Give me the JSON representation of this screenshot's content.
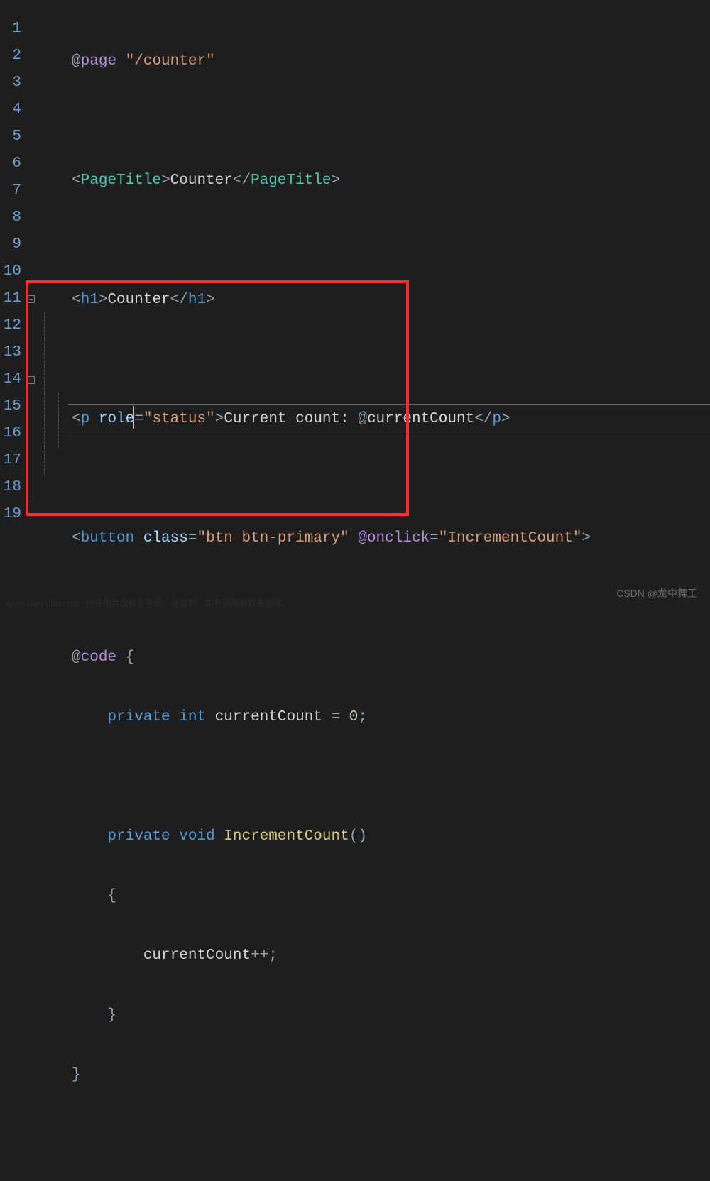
{
  "line_numbers": [
    "1",
    "2",
    "3",
    "4",
    "5",
    "6",
    "7",
    "8",
    "9",
    "10",
    "11",
    "12",
    "13",
    "14",
    "15",
    "16",
    "17",
    "18",
    "19"
  ],
  "code": {
    "l1": {
      "at": "@",
      "page": "page",
      "sp": " ",
      "q1": "\"",
      "path": "/counter",
      "q2": "\""
    },
    "l3": {
      "lt": "<",
      "tag": "PageTitle",
      "gt": ">",
      "text": "Counter",
      "lt2": "</",
      "tag2": "PageTitle",
      "gt2": ">"
    },
    "l5": {
      "lt": "<",
      "tag": "h1",
      "gt": ">",
      "text": "Counter",
      "lt2": "</",
      "tag2": "h1",
      "gt2": ">"
    },
    "l7": {
      "lt": "<",
      "tag": "p",
      "sp": " ",
      "attr": "role",
      "eq": "=",
      "q1": "\"",
      "val": "status",
      "q2": "\"",
      "gt": ">",
      "text": "Current count: ",
      "at": "@",
      "var": "currentCount",
      "lt2": "</",
      "tag2": "p",
      "gt2": ">"
    },
    "l9": {
      "lt": "<",
      "tag": "button",
      "sp": " ",
      "attr1": "class",
      "eq1": "=",
      "q1": "\"",
      "val1": "btn btn-primary",
      "q2": "\"",
      "sp2": " ",
      "attr2": "@onclick",
      "eq2": "=",
      "q3": "\"",
      "val2": "IncrementCount",
      "q4": "\"",
      "gt": ">"
    },
    "l11": {
      "at": "@",
      "code": "code",
      "sp": " ",
      "brace": "{"
    },
    "l12": {
      "kw1": "private",
      "sp1": " ",
      "type": "int",
      "sp2": " ",
      "name": "currentCount",
      "sp3": " ",
      "eq": "=",
      "sp4": " ",
      "num": "0",
      "semi": ";"
    },
    "l14": {
      "kw1": "private",
      "sp1": " ",
      "ret": "void",
      "sp2": " ",
      "name": "IncrementCount",
      "lp": "(",
      "rp": ")"
    },
    "l15": {
      "brace": "{"
    },
    "l16": {
      "name": "currentCount",
      "op": "++",
      "semi": ";"
    },
    "l17": {
      "brace": "}"
    },
    "l18": {
      "brace": "}"
    }
  },
  "watermark": "CSDN @龙中舞王",
  "footer_faint": "www.toymoban.com 网络图片仅供参考示…非复制，如有误用请联系删除。"
}
